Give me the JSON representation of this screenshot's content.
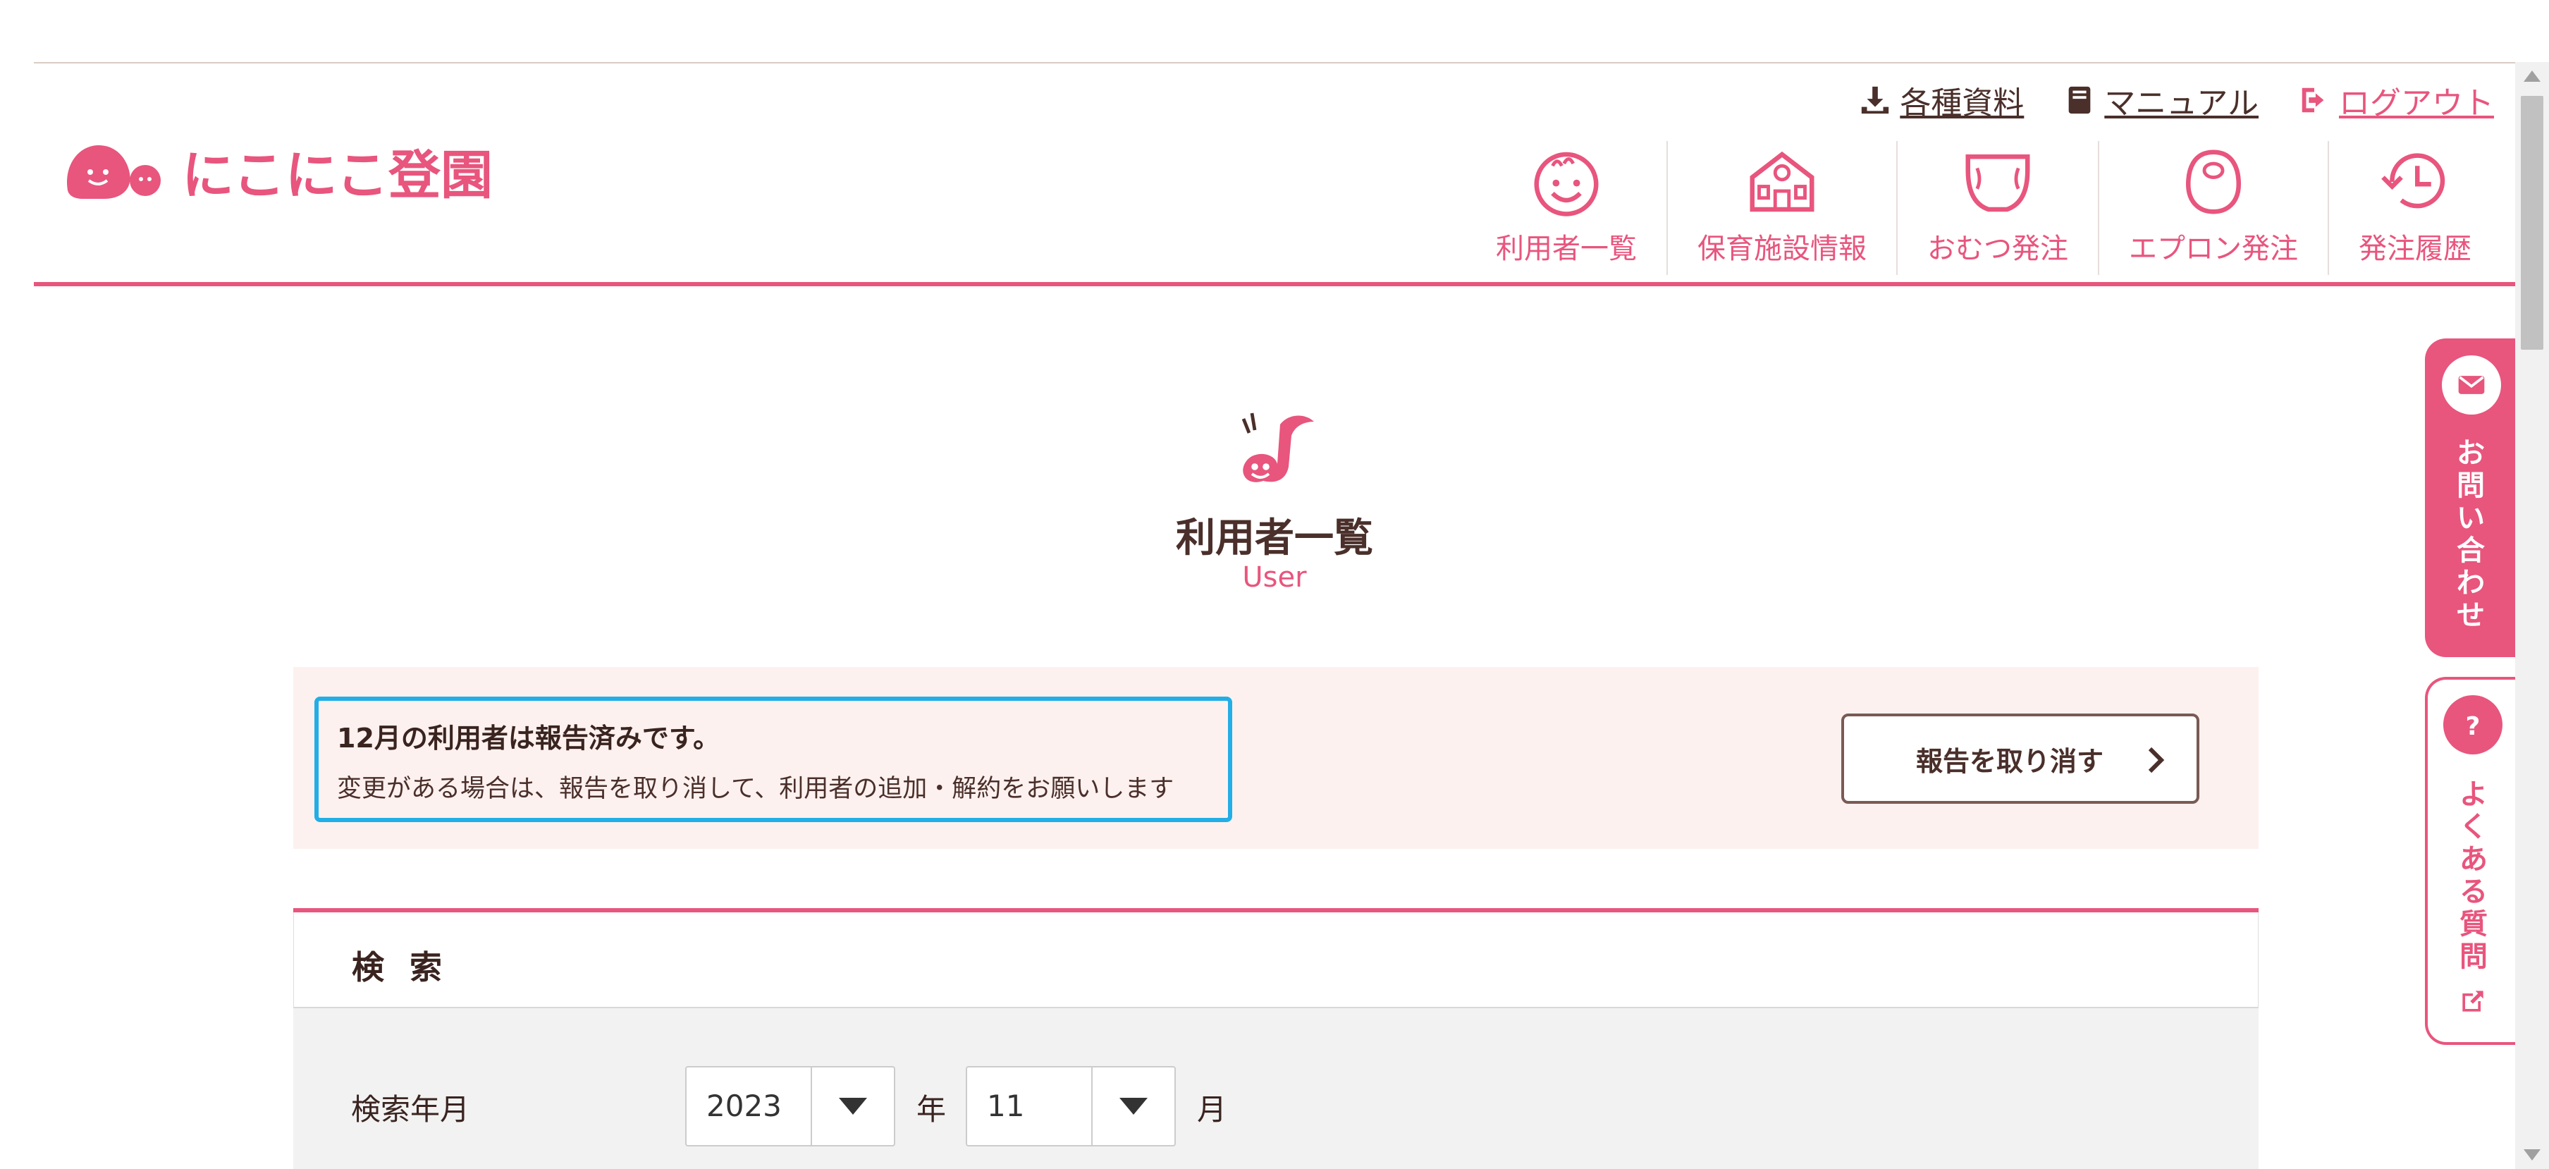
{
  "header": {
    "logo_text": "にこにこ登園",
    "utility_links": [
      {
        "label": "各種資料",
        "icon": "download-icon"
      },
      {
        "label": "マニュアル",
        "icon": "book-icon"
      },
      {
        "label": "ログアウト",
        "icon": "logout-icon"
      }
    ],
    "nav": [
      {
        "label": "利用者一覧",
        "icon": "smiley-face-icon"
      },
      {
        "label": "保育施設情報",
        "icon": "school-building-icon"
      },
      {
        "label": "おむつ発注",
        "icon": "diaper-icon"
      },
      {
        "label": "エプロン発注",
        "icon": "apron-bib-icon"
      },
      {
        "label": "発注履歴",
        "icon": "history-clock-icon"
      }
    ]
  },
  "page": {
    "icon": "music-note-mascot-icon",
    "title": "利用者一覧",
    "subtitle": "User"
  },
  "notice": {
    "title": "12月の利用者は報告済みです。",
    "text": "変更がある場合は、報告を取り消して、利用者の追加・解約をお願いします",
    "cancel_button": "報告を取り消す"
  },
  "search": {
    "title": "検 索",
    "label": "検索年月",
    "year_value": "2023",
    "year_unit": "年",
    "month_value": "11",
    "month_unit": "月"
  },
  "side": {
    "contact_label": "お問い合わせ",
    "faq_label": "よくある質問"
  },
  "colors": {
    "accent": "#e8557d",
    "text": "#4a2f2a",
    "notice_bg": "#fdf1ef",
    "highlight_border": "#22aee6"
  }
}
